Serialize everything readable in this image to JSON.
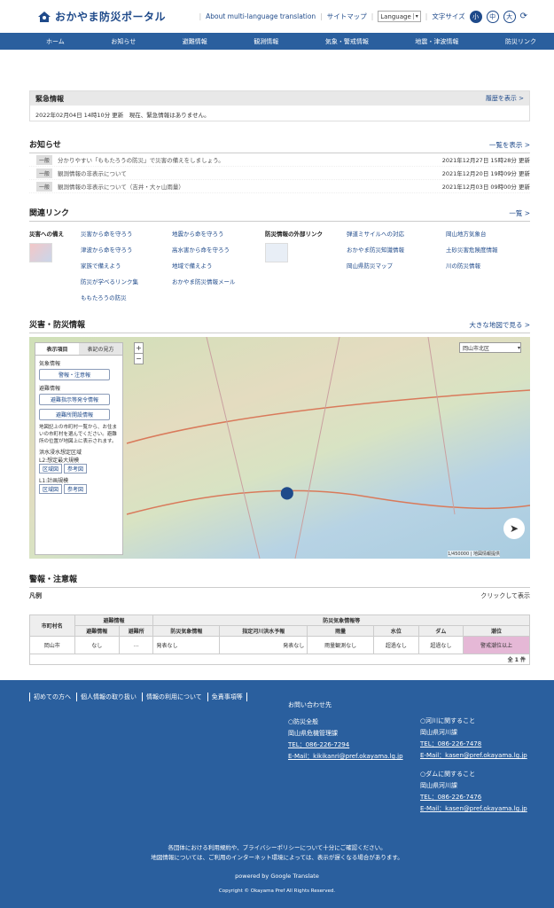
{
  "header": {
    "logo": "おかやま防災ポータル",
    "multi_lang": "About multi-language translation",
    "sitemap": "サイトマップ",
    "language": "Language",
    "font_size_label": "文字サイズ",
    "sizes": [
      "小",
      "中",
      "大"
    ]
  },
  "nav": [
    "ホーム",
    "お知らせ",
    "避難情報",
    "観測情報",
    "気象・警戒情報",
    "地震・津波情報",
    "防災リンク"
  ],
  "emergency": {
    "title": "緊急情報",
    "history": "履歴を表示 >",
    "text": "2022年02月04日 14時10分 更新　現在、緊急情報はありません。"
  },
  "news": {
    "title": "お知らせ",
    "more": "一覧を表示 >",
    "items": [
      {
        "tag": "一般",
        "text": "分かりやすい「ももたろうの防災」で災害の備えをしましょう。",
        "date": "2021年12月27日 15時28分 更新"
      },
      {
        "tag": "一般",
        "text": "観測情報の非表示について",
        "date": "2021年12月20日 19時09分 更新"
      },
      {
        "tag": "一般",
        "text": "観測情報の非表示について（吉井・大ヶ山雨量）",
        "date": "2021年12月03日 09時00分 更新"
      }
    ]
  },
  "links": {
    "title": "関連リンク",
    "more": "一覧 >",
    "cat1": "災害への備え",
    "col1": [
      "災害から命を守ろう",
      "津波から命を守ろう",
      "家族で備えよう",
      "防災が学べるリンク集",
      "ももたろうの防災"
    ],
    "col2": [
      "地震から命を守ろう",
      "高水害から命を守ろう",
      "地域で備えよう",
      "おかやま防災情報メール"
    ],
    "cat2": "防災情報の外部リンク",
    "col3": [
      "弾道ミサイルへの対応",
      "おかやま防災知識情報",
      "岡山県防災マップ"
    ],
    "col4": [
      "岡山地方気象台",
      "土砂災害危険度情報",
      "川の防災情報"
    ]
  },
  "disaster": {
    "title": "災害・防災情報",
    "more": "大きな地図で見る >",
    "tab1": "表示項目",
    "tab2": "表記の見方",
    "g1": "気象情報",
    "b1": "警報・注意報",
    "g2": "避難情報",
    "b2": "避難指示等発令情報",
    "b3": "避難所開設情報",
    "note": "地図記上の市町村一覧から、お住まいの市町村を選んでください。避難所の位置が地図上に表示されます。",
    "g3": "洪水浸水想定区域",
    "l2": "L2:想定最大規模",
    "l1": "L1:計画規模",
    "s1": "区域図",
    "s2": "参考図",
    "select": "岡山市北区",
    "scale": "1/450000 | 地図情報提供"
  },
  "warnings": {
    "title": "警報・注意報",
    "legend": "凡例",
    "click": "クリックして表示",
    "h_city": "市町村名",
    "h_evac": "避難情報",
    "h_info": "避難情報",
    "h_place": "避難所",
    "h_weather": "防災気象情報等",
    "h_wx": "防災気象情報",
    "h_flood": "指定河川洪水予報",
    "h_rain": "雨量",
    "h_level": "水位",
    "h_dam": "ダム",
    "h_tide": "潮位",
    "city": "岡山市",
    "info": "なし",
    "place": "…",
    "wx": "発表なし",
    "flood": "発表なし",
    "rain": "雨量観測なし",
    "level": "超過なし",
    "dam": "超過なし",
    "tide": "警戒潮位以上",
    "count": "全 1 件"
  },
  "footer": {
    "links": [
      "初めての方へ",
      "個人情報の取り扱い",
      "情報の利用について",
      "免責事項等"
    ],
    "contact": "お問い合わせ先",
    "c1": "○防災全般",
    "c1d": "岡山県危機管理課",
    "c1t": "TEL：086-226-7294",
    "c1m": "E-Mail：kikikanri@pref.okayama.lg.jp",
    "c2": "○河川に関すること",
    "c2d": "岡山県河川課",
    "c2t": "TEL：086-226-7478",
    "c2m": "E-Mail：kasen@pref.okayama.lg.jp",
    "c3": "○ダムに関すること",
    "c3d": "岡山県河川課",
    "c3t": "TEL：086-226-7476",
    "c3m": "E-Mail：kasen@pref.okayama.lg.jp",
    "note1": "各団体における利用規約や、プライバシーポリシーについて十分にご確認ください。",
    "note2": "地図情報については、ご利用のインターネット環境によっては、表示が遅くなる場合があります。",
    "powered": "powered by Google Translate",
    "copy": "Copyright © Okayama Pref All Rights Reserved."
  }
}
